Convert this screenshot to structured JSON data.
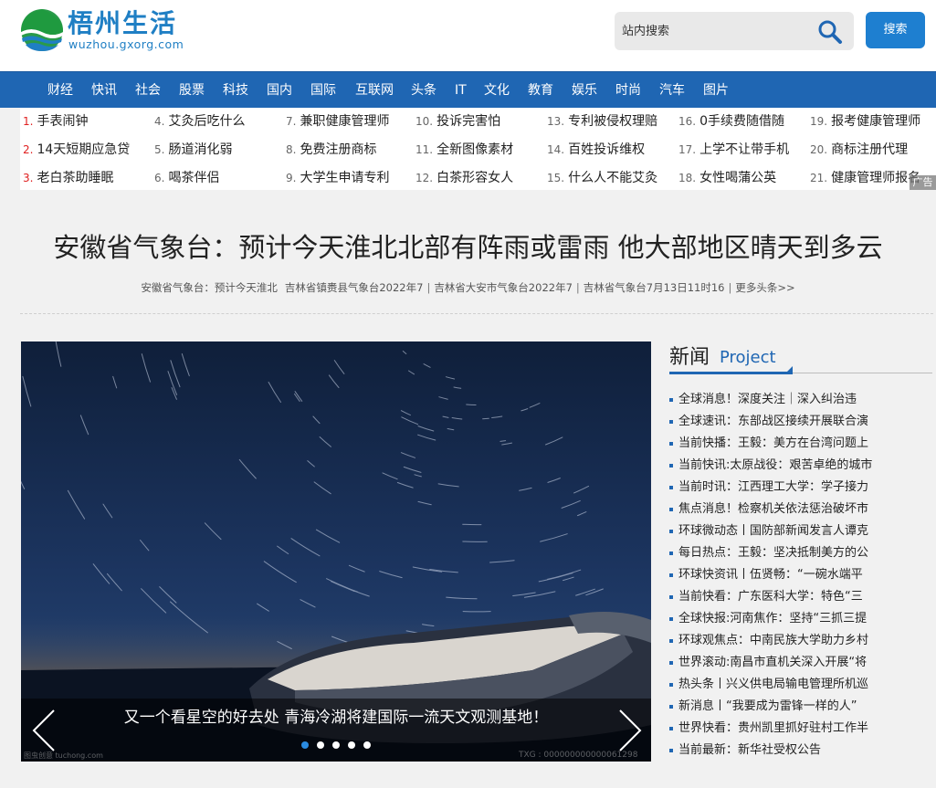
{
  "site": {
    "logo_title": "梧州生活",
    "logo_subtitle": "wuzhou.gxorg.com"
  },
  "search": {
    "placeholder": "站内搜索",
    "button_label": "搜索"
  },
  "nav": [
    "财经",
    "快讯",
    "社会",
    "股票",
    "科技",
    "国内",
    "国际",
    "互联网",
    "头条",
    "IT",
    "文化",
    "教育",
    "娱乐",
    "时尚",
    "汽车",
    "图片"
  ],
  "hot_links": [
    {
      "num": "1.",
      "text": "手表闹钟"
    },
    {
      "num": "2.",
      "text": "14天短期应急贷"
    },
    {
      "num": "3.",
      "text": "老白茶助睡眠"
    },
    {
      "num": "4.",
      "text": "艾灸后吃什么"
    },
    {
      "num": "5.",
      "text": "肠道消化弱"
    },
    {
      "num": "6.",
      "text": "喝茶伴侣"
    },
    {
      "num": "7.",
      "text": "兼职健康管理师"
    },
    {
      "num": "8.",
      "text": "免费注册商标"
    },
    {
      "num": "9.",
      "text": "大学生申请专利"
    },
    {
      "num": "10.",
      "text": "投诉完害怕"
    },
    {
      "num": "11.",
      "text": "全新图像素材"
    },
    {
      "num": "12.",
      "text": "白茶形容女人"
    },
    {
      "num": "13.",
      "text": "专利被侵权理赔"
    },
    {
      "num": "14.",
      "text": "百姓投诉维权"
    },
    {
      "num": "15.",
      "text": "什么人不能艾灸"
    },
    {
      "num": "16.",
      "text": "0手续费随借随"
    },
    {
      "num": "17.",
      "text": "上学不让带手机"
    },
    {
      "num": "18.",
      "text": "女性喝蒲公英"
    },
    {
      "num": "19.",
      "text": "报考健康管理师"
    },
    {
      "num": "20.",
      "text": "商标注册代理"
    },
    {
      "num": "21.",
      "text": "健康管理师报名"
    }
  ],
  "ad_tag": "广告",
  "headline": "安徽省气象台：预计今天淮北北部有阵雨或雷雨 他大部地区晴天到多云",
  "sub_news": [
    "安徽省气象台：预计今天淮北",
    "吉林省镇赉县气象台2022年7",
    "吉林省大安市气象台2022年7",
    "吉林省气象台7月13日11时16",
    "更多头条>>"
  ],
  "slider": {
    "caption": "又一个看星空的好去处 青海冷湖将建国际一流天文观测基地！",
    "dots_count": 5,
    "active_dot": 0,
    "watermark_left": "图虫创意 tuchong.com",
    "watermark_right": "TXG : 000000000000061298"
  },
  "news": {
    "title": "新闻",
    "subtitle": "Project",
    "items": [
      "全球消息！深度关注｜深入纠治违",
      "全球速讯：东部战区接续开展联合演",
      "当前快播：王毅：美方在台湾问题上",
      "当前快讯:太原战役：艰苦卓绝的城市",
      "当前时讯：江西理工大学：学子接力",
      "焦点消息！检察机关依法惩治破坏市",
      "环球微动态丨国防部新闻发言人谭克",
      "每日热点：王毅：坚决抵制美方的公",
      "环球快资讯丨伍贤畅：“一碗水端平",
      "当前快看：广东医科大学：特色“三",
      "全球快报:河南焦作：坚持“三抓三提",
      "环球观焦点：中南民族大学助力乡村",
      "世界滚动:南昌市直机关深入开展“将",
      "热头条丨兴义供电局输电管理所机巡",
      "新消息丨“我要成为雷锋一样的人”",
      "世界快看：贵州凯里抓好驻村工作半",
      "当前最新：新华社受权公告"
    ]
  },
  "colors": {
    "brand_blue": "#1f66b3",
    "button_blue": "#1e7fd0",
    "hot_red": "#e02020"
  }
}
